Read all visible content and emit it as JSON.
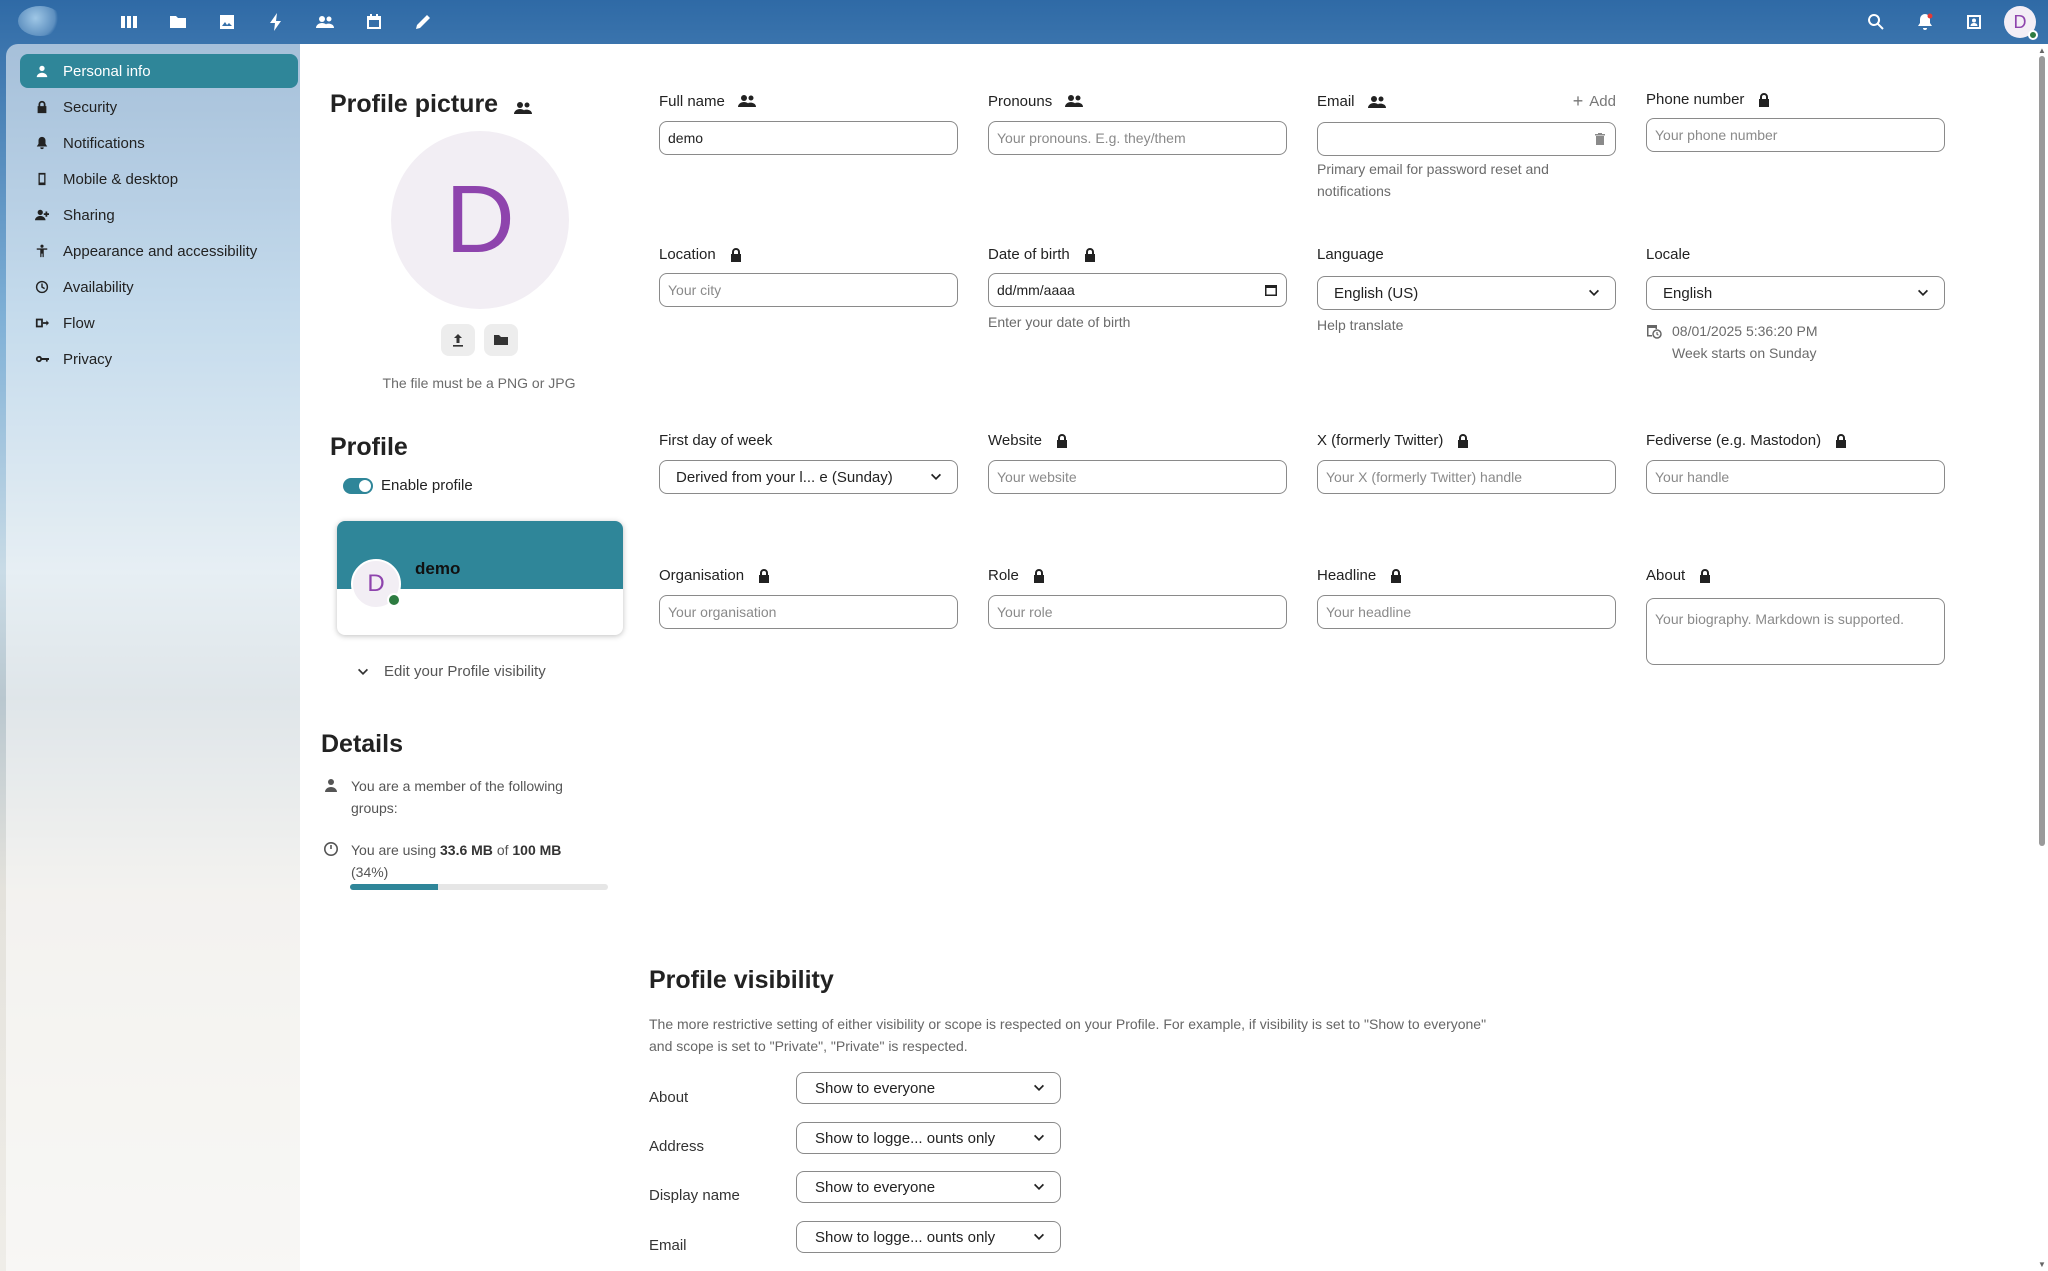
{
  "topbar": {
    "apps": [
      "dashboard-icon",
      "files-icon",
      "photos-icon",
      "activity-icon",
      "contacts-icon",
      "calendar-icon",
      "notes-icon"
    ],
    "right": [
      "search-icon",
      "notifications-icon",
      "contacts-menu-icon"
    ],
    "avatar_letter": "D"
  },
  "sidebar": {
    "items": [
      {
        "label": "Personal info",
        "icon": "person-icon"
      },
      {
        "label": "Security",
        "icon": "lock-icon"
      },
      {
        "label": "Notifications",
        "icon": "bell-icon"
      },
      {
        "label": "Mobile & desktop",
        "icon": "phone-icon"
      },
      {
        "label": "Sharing",
        "icon": "share-icon"
      },
      {
        "label": "Appearance and accessibility",
        "icon": "accessibility-icon"
      },
      {
        "label": "Availability",
        "icon": "clock-icon"
      },
      {
        "label": "Flow",
        "icon": "flow-icon"
      },
      {
        "label": "Privacy",
        "icon": "key-icon"
      }
    ]
  },
  "profile_picture": {
    "title": "Profile picture",
    "letter": "D",
    "hint": "The file must be a PNG or JPG"
  },
  "profile": {
    "title": "Profile",
    "enable_label": "Enable profile",
    "card_letter": "D",
    "card_name": "demo",
    "edit_visibility": "Edit your Profile visibility"
  },
  "details": {
    "title": "Details",
    "groups_text": "You are a member of the following groups:",
    "usage_prefix": "You are using",
    "usage_used": "33.6 MB",
    "usage_of": "of",
    "usage_total": "100 MB",
    "usage_percent": "(34%)",
    "usage_fraction": 0.34
  },
  "fields": {
    "full_name": {
      "label": "Full name",
      "value": "demo"
    },
    "pronouns": {
      "label": "Pronouns",
      "placeholder": "Your pronouns. E.g. they/them"
    },
    "email": {
      "label": "Email",
      "add": "Add",
      "helper": "Primary email for password reset and notifications"
    },
    "phone": {
      "label": "Phone number",
      "placeholder": "Your phone number"
    },
    "location": {
      "label": "Location",
      "placeholder": "Your city"
    },
    "dob": {
      "label": "Date of birth",
      "value": "dd/mm/aaaa",
      "helper": "Enter your date of birth"
    },
    "language": {
      "label": "Language",
      "value": "English (US)",
      "helper": "Help translate"
    },
    "locale": {
      "label": "Locale",
      "value": "English",
      "time": "08/01/2025 5:36:20 PM",
      "week": "Week starts on Sunday"
    },
    "first_day": {
      "label": "First day of week",
      "value": "Derived from your l... e (Sunday)"
    },
    "website": {
      "label": "Website",
      "placeholder": "Your website"
    },
    "twitter": {
      "label": "X (formerly Twitter)",
      "placeholder": "Your X (formerly Twitter) handle"
    },
    "fediverse": {
      "label": "Fediverse (e.g. Mastodon)",
      "placeholder": "Your handle"
    },
    "organisation": {
      "label": "Organisation",
      "placeholder": "Your organisation"
    },
    "role": {
      "label": "Role",
      "placeholder": "Your role"
    },
    "headline": {
      "label": "Headline",
      "placeholder": "Your headline"
    },
    "about": {
      "label": "About",
      "placeholder": "Your biography. Markdown is supported."
    }
  },
  "visibility": {
    "title": "Profile visibility",
    "desc": "The more restrictive setting of either visibility or scope is respected on your Profile. For example, if visibility is set to \"Show to everyone\" and scope is set to \"Private\", \"Private\" is respected.",
    "rows": [
      {
        "label": "About",
        "value": "Show to everyone"
      },
      {
        "label": "Address",
        "value": "Show to logge... ounts only"
      },
      {
        "label": "Display name",
        "value": "Show to everyone"
      },
      {
        "label": "Email",
        "value": "Show to logge... ounts only"
      }
    ]
  }
}
